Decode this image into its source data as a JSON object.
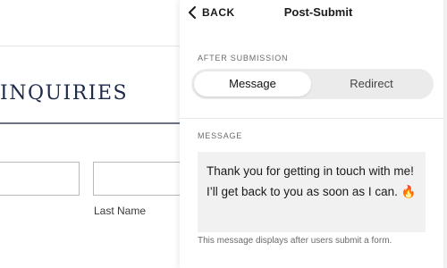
{
  "preview": {
    "heading": "INQUIRIES",
    "last_name_label": "Last Name"
  },
  "panel": {
    "back_label": "BACK",
    "title": "Post-Submit",
    "after_submission_label": "AFTER SUBMISSION",
    "tabs": [
      {
        "label": "Message",
        "selected": true
      },
      {
        "label": "Redirect",
        "selected": false
      }
    ],
    "message_label": "MESSAGE",
    "message_text": "Thank you for getting in touch with me! I’ll get back to you as soon as I can. 🔥",
    "helper_text": "This message displays after users submit a form."
  }
}
